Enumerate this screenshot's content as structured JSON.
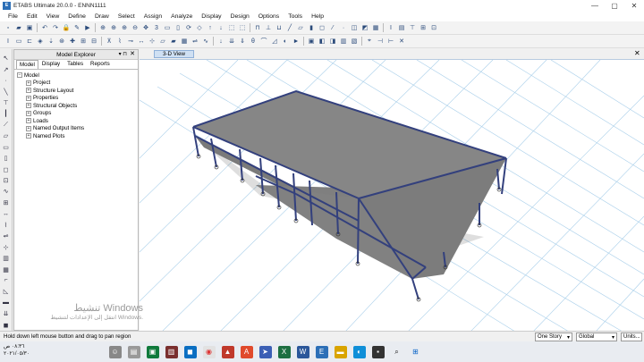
{
  "window": {
    "app_icon_text": "E",
    "title": "ETABS Ultimate 20.0.0 - ENNN1111",
    "min": "—",
    "max": "▢",
    "close": "✕"
  },
  "menu": [
    "File",
    "Edit",
    "View",
    "Define",
    "Draw",
    "Select",
    "Assign",
    "Analyze",
    "Display",
    "Design",
    "Options",
    "Tools",
    "Help"
  ],
  "explorer": {
    "title": "Model Explorer",
    "pin": "▾ ⊓",
    "close": "✕",
    "tabs": [
      "Model",
      "Display",
      "Tables",
      "Reports"
    ],
    "root": "Model",
    "items": [
      "Project",
      "Structure Layout",
      "Properties",
      "Structural Objects",
      "Groups",
      "Loads",
      "Named Output Items",
      "Named Plots"
    ]
  },
  "view": {
    "tab_label": "3-D View",
    "close": "✕"
  },
  "status": {
    "message": "Hold down left mouse button and drag to pan region",
    "story": "One Story",
    "coord": "Global",
    "units": "Units..."
  },
  "watermark": {
    "line1": "تنشيط Windows",
    "line2": "انتقل إلى الإعدادات لتنشيط Windows."
  },
  "clock": {
    "time": "٠٨:٣٦ ص",
    "date": "٢٠٢١/٠٥/٣٠"
  },
  "colors": {
    "frame": "#33407d",
    "roof": "#808080",
    "grid": "#a9cfea",
    "accent": "#2c6fb7"
  }
}
